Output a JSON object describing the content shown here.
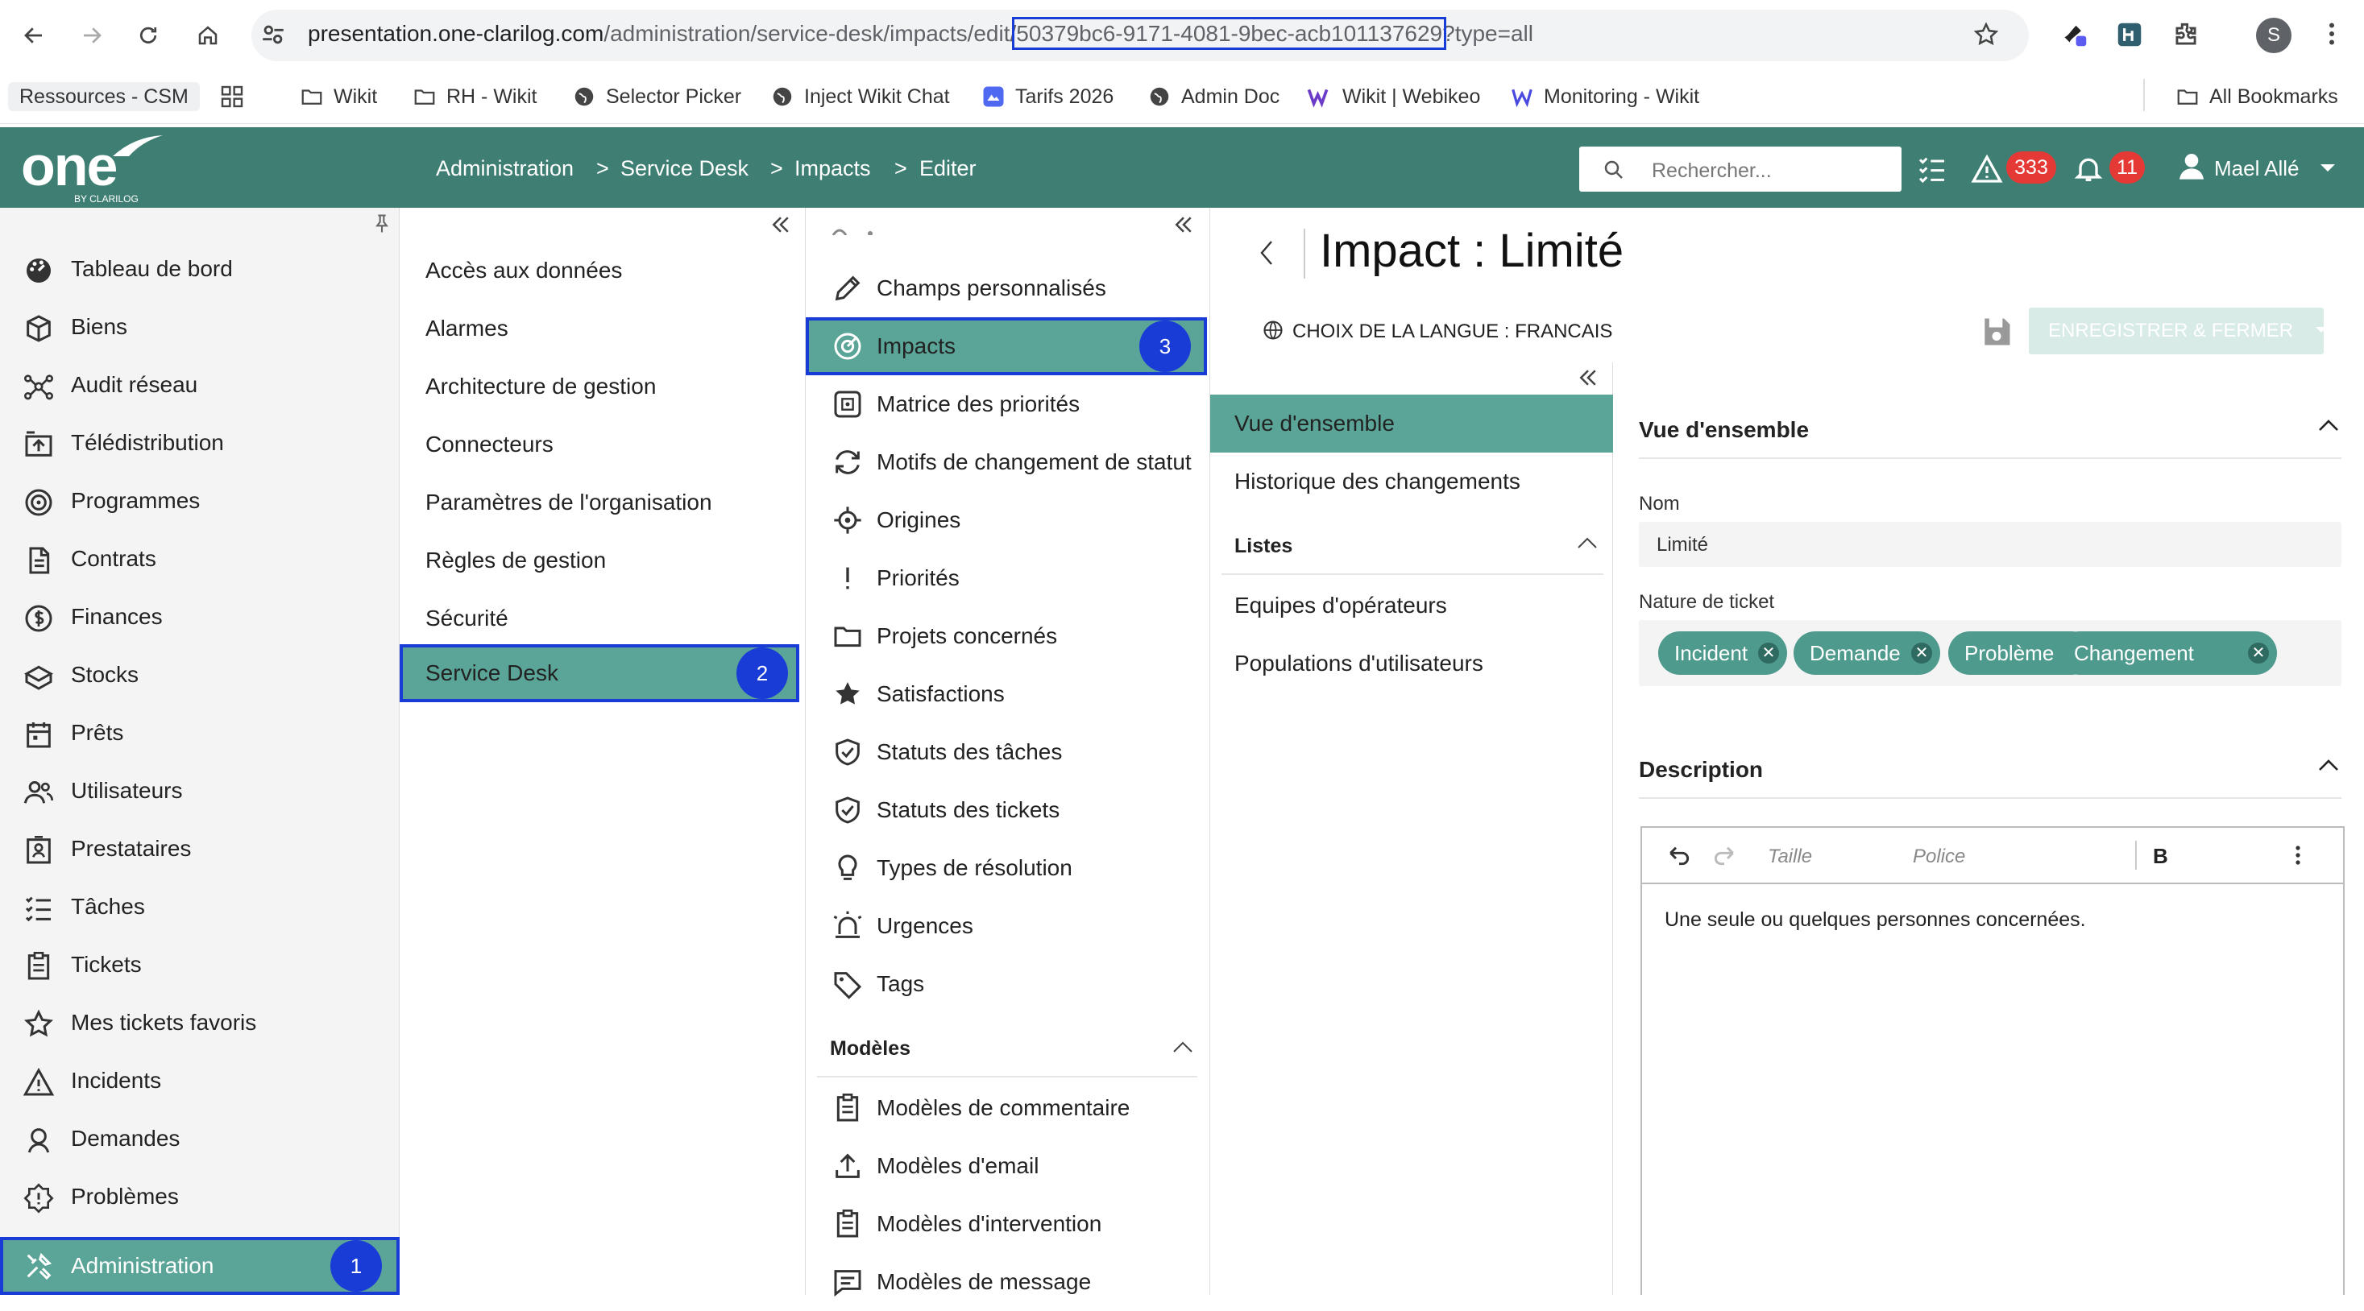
{
  "browser": {
    "url_host": "presentation.one-clarilog.com",
    "url_path": "/administration/service-desk/impacts/edit/",
    "url_id": "50379bc6-9171-4081-9bec-acb101137629",
    "url_query": "?type=all",
    "profile_initial": "S",
    "bookmarks": [
      "Ressources - CSM",
      "Wikit",
      "RH - Wikit",
      "Selector Picker",
      "Inject Wikit Chat",
      "Tarifs 2026",
      "Admin Doc",
      "Wikit | Webikeo",
      "Monitoring - Wikit"
    ],
    "all_bookmarks": "All Bookmarks"
  },
  "app": {
    "logo": "one",
    "logo_sub": "BY CLARILOG",
    "breadcrumb": [
      "Administration",
      "Service Desk",
      "Impacts",
      "Editer"
    ],
    "search_placeholder": "Rechercher...",
    "alerts_count": "333",
    "notifications_count": "11",
    "user_name": "Mael Allé"
  },
  "sidebar": {
    "items": [
      {
        "label": "Tableau de bord",
        "icon": "dashboard-icon"
      },
      {
        "label": "Biens",
        "icon": "box-icon"
      },
      {
        "label": "Audit réseau",
        "icon": "network-icon"
      },
      {
        "label": "Télédistribution",
        "icon": "distribution-icon"
      },
      {
        "label": "Programmes",
        "icon": "programs-icon"
      },
      {
        "label": "Contrats",
        "icon": "contract-icon"
      },
      {
        "label": "Finances",
        "icon": "finance-icon"
      },
      {
        "label": "Stocks",
        "icon": "stock-icon"
      },
      {
        "label": "Prêts",
        "icon": "calendar-icon"
      },
      {
        "label": "Utilisateurs",
        "icon": "users-icon"
      },
      {
        "label": "Prestataires",
        "icon": "provider-icon"
      },
      {
        "label": "Tâches",
        "icon": "tasks-icon"
      },
      {
        "label": "Tickets",
        "icon": "ticket-icon"
      },
      {
        "label": "Mes tickets favoris",
        "icon": "star-icon"
      },
      {
        "label": "Incidents",
        "icon": "warning-icon"
      },
      {
        "label": "Demandes",
        "icon": "request-icon"
      },
      {
        "label": "Problèmes",
        "icon": "problem-icon"
      }
    ],
    "active": "Administration",
    "active_marker": "1"
  },
  "admin_menu": {
    "items": [
      "Accès aux données",
      "Alarmes",
      "Architecture de gestion",
      "Connecteurs",
      "Paramètres de l'organisation",
      "Règles de gestion",
      "Sécurité"
    ],
    "active": "Service Desk",
    "active_marker": "2"
  },
  "servicedesk_menu": {
    "items": [
      {
        "label": "Champs personnalisés",
        "icon": "pencil-icon"
      },
      {
        "label": "Impacts",
        "icon": "impact-icon"
      },
      {
        "label": "Matrice des priorités",
        "icon": "matrix-icon"
      },
      {
        "label": "Motifs de changement de statut",
        "icon": "cycle-icon"
      },
      {
        "label": "Origines",
        "icon": "target-icon"
      },
      {
        "label": "Priorités",
        "icon": "exclamation-icon"
      },
      {
        "label": "Projets concernés",
        "icon": "folder-icon"
      },
      {
        "label": "Satisfactions",
        "icon": "star-filled-icon"
      },
      {
        "label": "Statuts des tâches",
        "icon": "shield-check-icon"
      },
      {
        "label": "Statuts des tickets",
        "icon": "shield-check-icon"
      },
      {
        "label": "Types de résolution",
        "icon": "bulb-icon"
      },
      {
        "label": "Urgences",
        "icon": "siren-icon"
      },
      {
        "label": "Tags",
        "icon": "tag-icon"
      }
    ],
    "active_marker": "3",
    "section_models": "Modèles",
    "models": [
      {
        "label": "Modèles de commentaire",
        "icon": "clipboard-icon"
      },
      {
        "label": "Modèles d'email",
        "icon": "upload-icon"
      },
      {
        "label": "Modèles d'intervention",
        "icon": "clipboard-icon"
      },
      {
        "label": "Modèles de message",
        "icon": "message-icon"
      }
    ]
  },
  "detail": {
    "title": "Impact : Limité",
    "language_label": "CHOIX DE LA LANGUE : FRANCAIS",
    "save_close_label": "ENREGISTRER & FERMER",
    "tabs": [
      "Vue d'ensemble",
      "Historique des changements"
    ],
    "lists_header": "Listes",
    "lists": [
      "Equipes d'opérateurs",
      "Populations d'utilisateurs"
    ],
    "overview_header": "Vue d'ensemble",
    "name_label": "Nom",
    "name_value": "Limité",
    "ticket_nature_label": "Nature de ticket",
    "ticket_natures": [
      "Incident",
      "Demande",
      "Problème",
      "Changement"
    ],
    "description_header": "Description",
    "editor_size": "Taille",
    "editor_font": "Police",
    "editor_bold": "B",
    "description_text": "Une seule ou quelques personnes concernées."
  }
}
